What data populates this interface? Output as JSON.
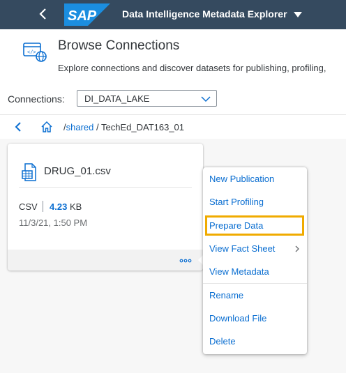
{
  "shell": {
    "title": "Data Intelligence Metadata Explorer",
    "logo_text": "SAP",
    "accent": "#354a5f",
    "logo_color": "#1b8ee0"
  },
  "header": {
    "title": "Browse Connections",
    "subtitle": "Explore connections and discover datasets for publishing, profiling,"
  },
  "connections": {
    "label": "Connections:",
    "selected": "DI_DATA_LAKE"
  },
  "breadcrumb": {
    "link": "shared",
    "sep1": "/",
    "sep2": "/",
    "current": "TechEd_DAT163_01"
  },
  "card": {
    "file_name": "DRUG_01.csv",
    "file_type": "CSV",
    "size_value": "4.23",
    "size_unit": "KB",
    "date": "11/3/21, 1:50 PM"
  },
  "menu": {
    "items": [
      {
        "label": "New Publication"
      },
      {
        "label": "Start Profiling"
      },
      {
        "label": "Prepare Data"
      },
      {
        "label": "View Fact Sheet"
      },
      {
        "label": "View Metadata"
      },
      {
        "label": "Rename"
      },
      {
        "label": "Download File"
      },
      {
        "label": "Delete"
      }
    ],
    "highlight_color": "#f0ab00"
  }
}
